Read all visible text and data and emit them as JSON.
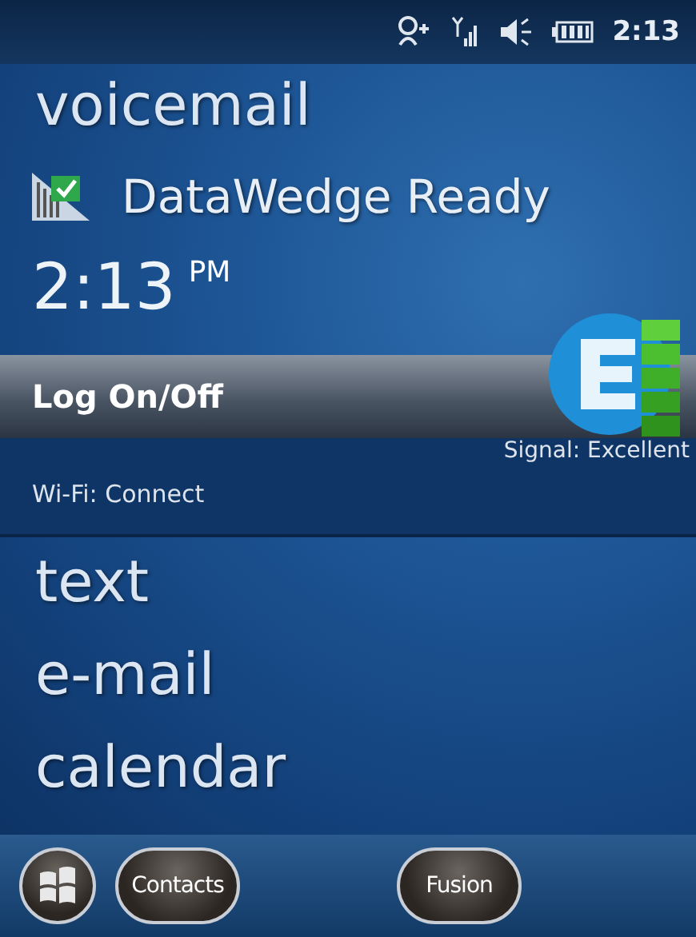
{
  "status_bar": {
    "time": "2:13"
  },
  "items": [
    {
      "kind": "large",
      "label": "voicemail",
      "selected": false
    },
    {
      "kind": "status",
      "label": "DataWedge Ready",
      "selected": false
    },
    {
      "kind": "clock",
      "label": "2:13",
      "suffix": "PM",
      "selected": false
    },
    {
      "kind": "plugin",
      "label": "Log On/Off",
      "signal": "Signal: Excellent",
      "wifi": "Wi-Fi: Connect",
      "selected": true
    },
    {
      "kind": "large",
      "label": "text",
      "selected": false
    },
    {
      "kind": "large",
      "label": "e-mail",
      "selected": false
    },
    {
      "kind": "large",
      "label": "calendar",
      "selected": false
    }
  ],
  "softkeys": [
    {
      "kind": "start"
    },
    {
      "kind": "label",
      "label": "Contacts"
    },
    {
      "kind": "label",
      "label": "Fusion"
    }
  ]
}
